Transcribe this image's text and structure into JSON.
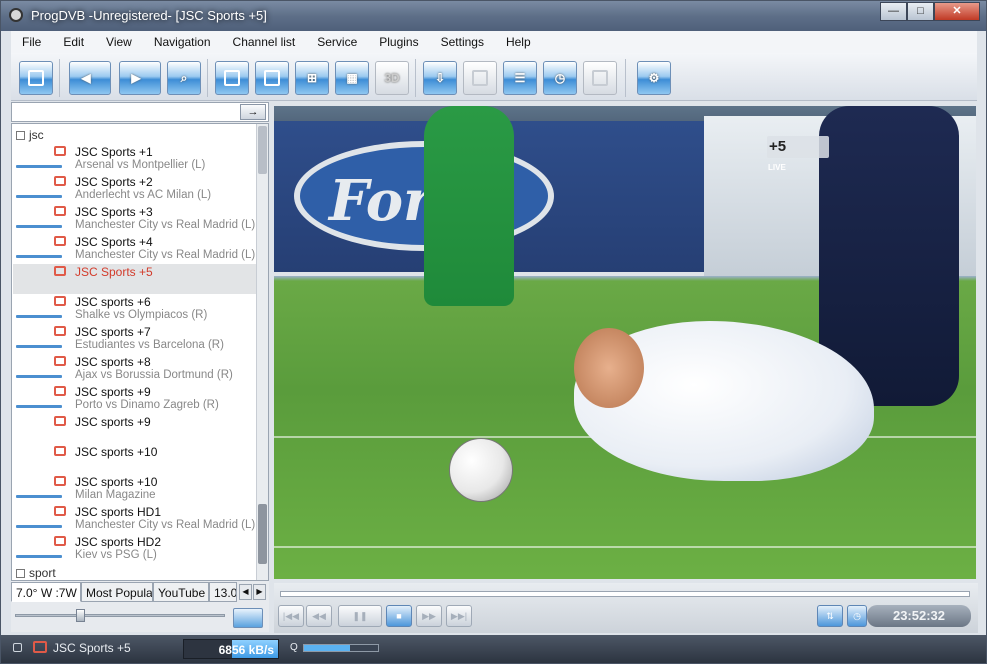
{
  "window": {
    "title": "ProgDVB -Unregistered-  [JSC Sports +5]",
    "minimize": "—",
    "maximize": "□",
    "close": "✕"
  },
  "menu": [
    "File",
    "Edit",
    "View",
    "Navigation",
    "Channel list",
    "Service",
    "Plugins",
    "Settings",
    "Help"
  ],
  "toolbar": {
    "btn_3d": "3D"
  },
  "channel_list": {
    "search_button": "→",
    "group_jsc": "jsc",
    "group_sport": "sport",
    "items": [
      {
        "name": "JSC Sports +1",
        "program": "Arsenal vs Montpellier (L)"
      },
      {
        "name": "JSC Sports +2",
        "program": "Anderlecht vs AC Milan (L)"
      },
      {
        "name": "JSC Sports +3",
        "program": "Manchester City vs Real Madrid (L)"
      },
      {
        "name": "JSC Sports +4",
        "program": "Manchester City vs Real Madrid (L)"
      },
      {
        "name": "JSC Sports +5",
        "program": ""
      },
      {
        "name": "JSC sports +6",
        "program": "Shalke vs Olympiacos (R)"
      },
      {
        "name": "JSC sports +7",
        "program": "Estudiantes vs Barcelona (R)"
      },
      {
        "name": "JSC sports +8",
        "program": "Ajax vs  Borussia Dortmund (R)"
      },
      {
        "name": "JSC sports +9",
        "program": "Porto vs  Dinamo Zagreb (R)"
      },
      {
        "name": "JSC sports +9",
        "program": ""
      },
      {
        "name": "JSC sports +10",
        "program": ""
      },
      {
        "name": "JSC sports +10",
        "program": "Milan Magazine"
      },
      {
        "name": "JSC sports HD1",
        "program": "Manchester City vs Real Madrid (L)"
      },
      {
        "name": "JSC sports HD2",
        "program": "Kiev vs PSG (L)"
      }
    ]
  },
  "tabs": [
    "7.0° W :7W",
    "Most Popular",
    "YouTube",
    "13.0"
  ],
  "tab_nav": {
    "left": "◀",
    "right": "▶"
  },
  "video": {
    "board_text": "Ford",
    "channel_logo": "+5",
    "live_label": "LIVE"
  },
  "controls": {
    "prev": "|◀◀",
    "rewind": "◀◀",
    "pause": "❚❚",
    "stop": "■",
    "forward": "▶▶",
    "next": "▶▶|",
    "time": "23:52:32"
  },
  "status": {
    "channel": "JSC Sports +5",
    "bitrate": "6856 kB/s",
    "quality_label": "Q"
  },
  "colors": {
    "selected_channel": "#d23b2b",
    "accent": "#3d8dd6",
    "tv_icon": "#e05a48"
  }
}
